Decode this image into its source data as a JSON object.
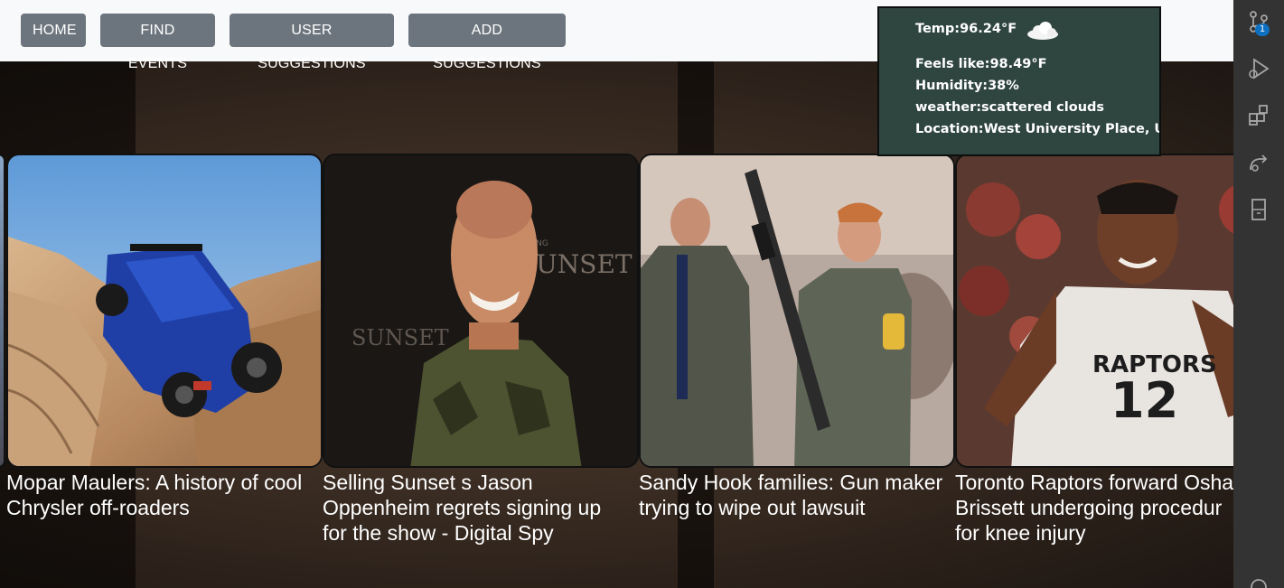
{
  "nav": {
    "home": "HOME",
    "find_events": "FIND EVENTS",
    "user_suggestions": "USER SUGGESTIONS",
    "add_suggestions": "ADD SUGGESTIONS"
  },
  "weather": {
    "temp": "Temp:96.24°F",
    "feels_like": "Feels like:98.49°F",
    "humidity": "Humidity:38%",
    "description": "weather:scattered clouds",
    "location": "Location:West University Place, US",
    "icon": "cloud-icon"
  },
  "cards": [
    {
      "title_lines": [
        "Mopar Maulers: A history of cool",
        "Chrysler off-roaders"
      ],
      "image": "blue-jeep-on-rocks"
    },
    {
      "title_lines": [
        "Selling Sunset s Jason",
        "Oppenheim regrets signing up",
        "for the show - Digital Spy"
      ],
      "image": "man-selling-sunset-backdrop"
    },
    {
      "title_lines": [
        "Sandy Hook families: Gun maker",
        "trying to wipe out lawsuit"
      ],
      "image": "officer-holding-rifle"
    },
    {
      "title_lines": [
        "Toronto Raptors forward Osha",
        "Brissett undergoing procedur",
        "for knee injury"
      ],
      "image": "raptors-player-12"
    }
  ],
  "sidebar": {
    "badge": "1",
    "icons": [
      "source-control-icon",
      "run-debug-icon",
      "extensions-icon",
      "remote-icon",
      "notebook-icon",
      "settings-gear-icon"
    ]
  },
  "colors": {
    "nav_button": "#6c757d",
    "nav_bar": "#f8f9fa",
    "weather_bg": "#2f4540",
    "sidebar_bg": "#333333",
    "badge": "#0e70c0"
  }
}
